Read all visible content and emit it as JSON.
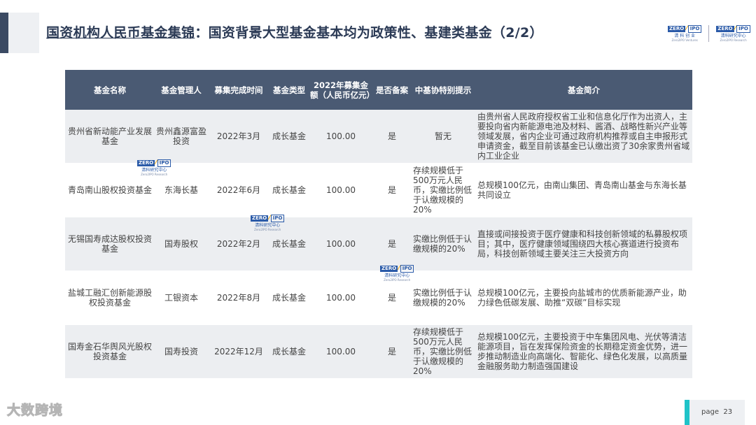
{
  "header": {
    "title_underlined": "国资机构人民币基金集锦",
    "title_rest": "：国资背景大型基金基本均为政策性、基建类基金（2/2）"
  },
  "logos": {
    "zero": "ZERO",
    "ipo": "IPO",
    "logo1_sub": "清 科 创 业",
    "logo1_sub2": "Zero2IPO Ventures",
    "logo2_sub": "清科研究中心",
    "logo2_sub2": "Zero2IPO Research"
  },
  "table": {
    "headers": [
      "基金名称",
      "基金管理人",
      "募集完成时间",
      "基金类型",
      "2022年募集金额（人民币亿元）",
      "是否备案",
      "中基协特别提示",
      "基金简介"
    ],
    "rows": [
      {
        "name": "贵州省新动能产业发展基金",
        "manager": "贵州鑫源富盈投资",
        "date": "2022年3月",
        "type": "成长基金",
        "amount": "100.00",
        "filed": "是",
        "note": "暂无",
        "desc": "由贵州省人民政府授权省工业和信息化厅作为出资人，主要投向省内新能源电池及材料、酱酒、战略性新兴产业等领域发展，省内企业可通过政府机构推荐或自主申报形式申请资金，截至目前该基金已认缴出资了30余家贵州省域内工业企业"
      },
      {
        "name": "青岛南山股权投资基金",
        "manager": "东海长基",
        "date": "2022年6月",
        "type": "成长基金",
        "amount": "100.00",
        "filed": "是",
        "note": "存续规模低于500万元人民币，实缴比例低于认缴规模的20%",
        "desc": "总规模100亿元，由南山集团、青岛南山基金与东海长基共同设立"
      },
      {
        "name": "无锡国寿成达股权投资基金",
        "manager": "国寿股权",
        "date": "2022年2月",
        "type": "成长基金",
        "amount": "100.00",
        "filed": "是",
        "note": "实缴比例低于认缴规模的20%",
        "desc": "直接或间接投资于医疗健康和科技创新领域的私募股权项目；其中，医疗健康领域围绕四大核心赛道进行投资布局，科技创新领域主要关注三大投资方向"
      },
      {
        "name": "盐城工融汇创新能源股权投资基金",
        "manager": "工银资本",
        "date": "2022年8月",
        "type": "成长基金",
        "amount": "100.00",
        "filed": "是",
        "note": "实缴比例低于认缴规模的20%",
        "desc": "总规模100亿元，主要投向盐城市的优质新能源产业，助力绿色低碳发展、助推“双碳”目标实现"
      },
      {
        "name": "国寿金石华舆风光股权投资基金",
        "manager": "国寿投资",
        "date": "2022年12月",
        "type": "成长基金",
        "amount": "100.00",
        "filed": "是",
        "note": "存续规模低于500万元人民币，实缴比例低于认缴规模的20%",
        "desc": "总规模100亿元，主要投资于中车集团风电、光伏等清洁能源项目，旨在发挥保险资金的长期稳定资金优势，进一步推动制造业向高端化、智能化、绿色化发展，以高质量金融服务助力制造强国建设"
      }
    ]
  },
  "footer": {
    "brand": "大数跨境",
    "page_label": "page",
    "page_number": "23"
  }
}
